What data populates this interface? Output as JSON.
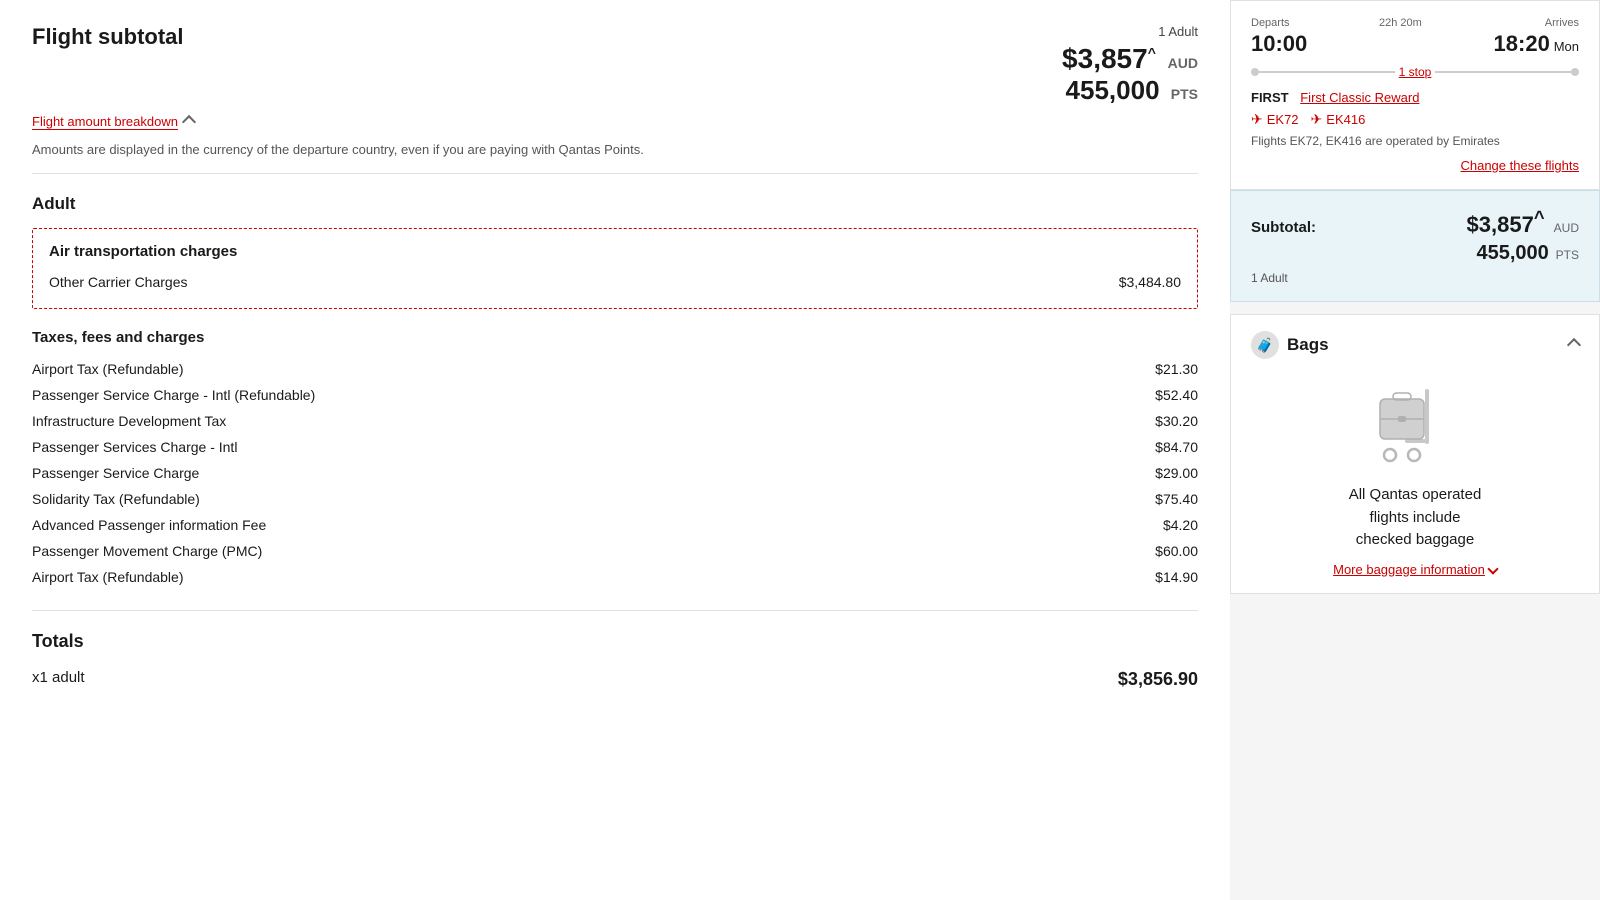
{
  "page": {
    "title": "Flight subtotal"
  },
  "flight_subtotal": {
    "title": "Flight subtotal",
    "adult_count": "1 Adult",
    "price_aud": "$3,857",
    "price_caret": "^",
    "price_currency": "AUD",
    "price_pts": "455,000",
    "pts_label": "PTS",
    "breakdown_link": "Flight amount breakdown",
    "notice": "Amounts are displayed in the currency of the departure country, even if you are paying with Qantas Points."
  },
  "adult_section": {
    "title": "Adult"
  },
  "air_transport": {
    "title": "Air transportation charges",
    "charges": [
      {
        "label": "Other Carrier Charges",
        "amount": "$3,484.80"
      }
    ]
  },
  "taxes": {
    "title": "Taxes, fees and charges",
    "items": [
      {
        "label": "Airport Tax (Refundable)",
        "amount": "$21.30"
      },
      {
        "label": "Passenger Service Charge - Intl (Refundable)",
        "amount": "$52.40"
      },
      {
        "label": "Infrastructure Development Tax",
        "amount": "$30.20"
      },
      {
        "label": "Passenger Services Charge - Intl",
        "amount": "$84.70"
      },
      {
        "label": "Passenger Service Charge",
        "amount": "$29.00"
      },
      {
        "label": "Solidarity Tax (Refundable)",
        "amount": "$75.40"
      },
      {
        "label": "Advanced Passenger information Fee",
        "amount": "$4.20"
      },
      {
        "label": "Passenger Movement Charge (PMC)",
        "amount": "$60.00"
      },
      {
        "label": "Airport Tax (Refundable)",
        "amount": "$14.90"
      }
    ]
  },
  "totals": {
    "title": "Totals",
    "rows": [
      {
        "label": "x1 adult",
        "amount": "$3,856.90"
      }
    ]
  },
  "sidebar": {
    "flight_card": {
      "departs_label": "Departs",
      "departs_time": "10:00",
      "duration_label": "22h 20m",
      "arrives_label": "Arrives",
      "arrives_time": "18:20",
      "arrives_day": "Mon",
      "stop_link": "1 stop",
      "class_first": "FIRST",
      "class_type": "First Classic Reward",
      "flight_codes": [
        {
          "code": "EK72"
        },
        {
          "code": "EK416"
        }
      ],
      "operated_by": "Flights EK72, EK416 are operated by Emirates",
      "change_flights_link": "Change these flights"
    },
    "subtotal_card": {
      "label": "Subtotal:",
      "price": "$3,857",
      "caret": "^",
      "currency": "AUD",
      "pts": "455,000",
      "pts_label": "PTS",
      "adult": "1 Adult"
    },
    "bags_card": {
      "title": "Bags",
      "description": "All Qantas operated\nflights include\nchecked baggage",
      "baggage_info_link": "More baggage information"
    }
  }
}
